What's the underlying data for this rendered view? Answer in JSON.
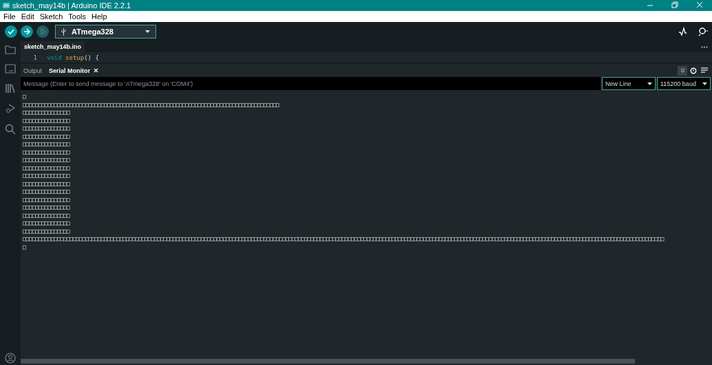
{
  "window": {
    "title": "sketch_may14b | Arduino IDE 2.2.1"
  },
  "menu": [
    "File",
    "Edit",
    "Sketch",
    "Tools",
    "Help"
  ],
  "toolbar": {
    "board": "ATmega328"
  },
  "editor": {
    "tab": "sketch_may14b.ino",
    "line_number": "1",
    "code": [
      {
        "kind": "keyword",
        "text": "void"
      },
      {
        "kind": "function",
        "text": "setup"
      },
      {
        "kind": "plain",
        "text": "() {"
      }
    ]
  },
  "panel": {
    "tabs": [
      {
        "label": "Output",
        "selected": false
      },
      {
        "label": "Serial Monitor",
        "selected": true
      }
    ],
    "message": {
      "placeholder": "Message (Enter to send message to 'ATmega328' on 'COM4')"
    },
    "line_ending": "New Line",
    "baud": "115200 baud",
    "lines": [
      "□",
      "□□□□□□□□□□□□□□□□□□□□□□□□□□□□□□□□□□□□□□□□□□□□□□□□□□□□□□□□□□□□□□□□□□□□□□□□□□□□□□□□□□",
      "□□□□□□□□□□□□□□□",
      "□□□□□□□□□□□□□□□",
      "□□□□□□□□□□□□□□□",
      "□□□□□□□□□□□□□□□",
      "□□□□□□□□□□□□□□□",
      "□□□□□□□□□□□□□□□",
      "□□□□□□□□□□□□□□□",
      "□□□□□□□□□□□□□□□",
      "□□□□□□□□□□□□□□□",
      "□□□□□□□□□□□□□□□",
      "□□□□□□□□□□□□□□□",
      "□□□□□□□□□□□□□□□",
      "□□□□□□□□□□□□□□□",
      "□□□□□□□□□□□□□□□",
      "□□□□□□□□□□□□□□□",
      "□□□□□□□□□□□□□□□",
      "□□□□□□□□□□□□□□□□□□□□□□□□□□□□□□□□□□□□□□□□□□□□□□□□□□□□□□□□□□□□□□□□□□□□□□□□□□□□□□□□□□□□□□□□□□□□□□□□□□□□□□□□□□□□□□□□□□□□□□□□□□□□□□□□□□□□□□□□□□□□□□□□□□□□□□□□□□□□□□□□□□□□□□□□□□□□□□□□□□□□□□□□□□□□□□□□□□□□□□□□□□□□□",
      "□"
    ]
  }
}
